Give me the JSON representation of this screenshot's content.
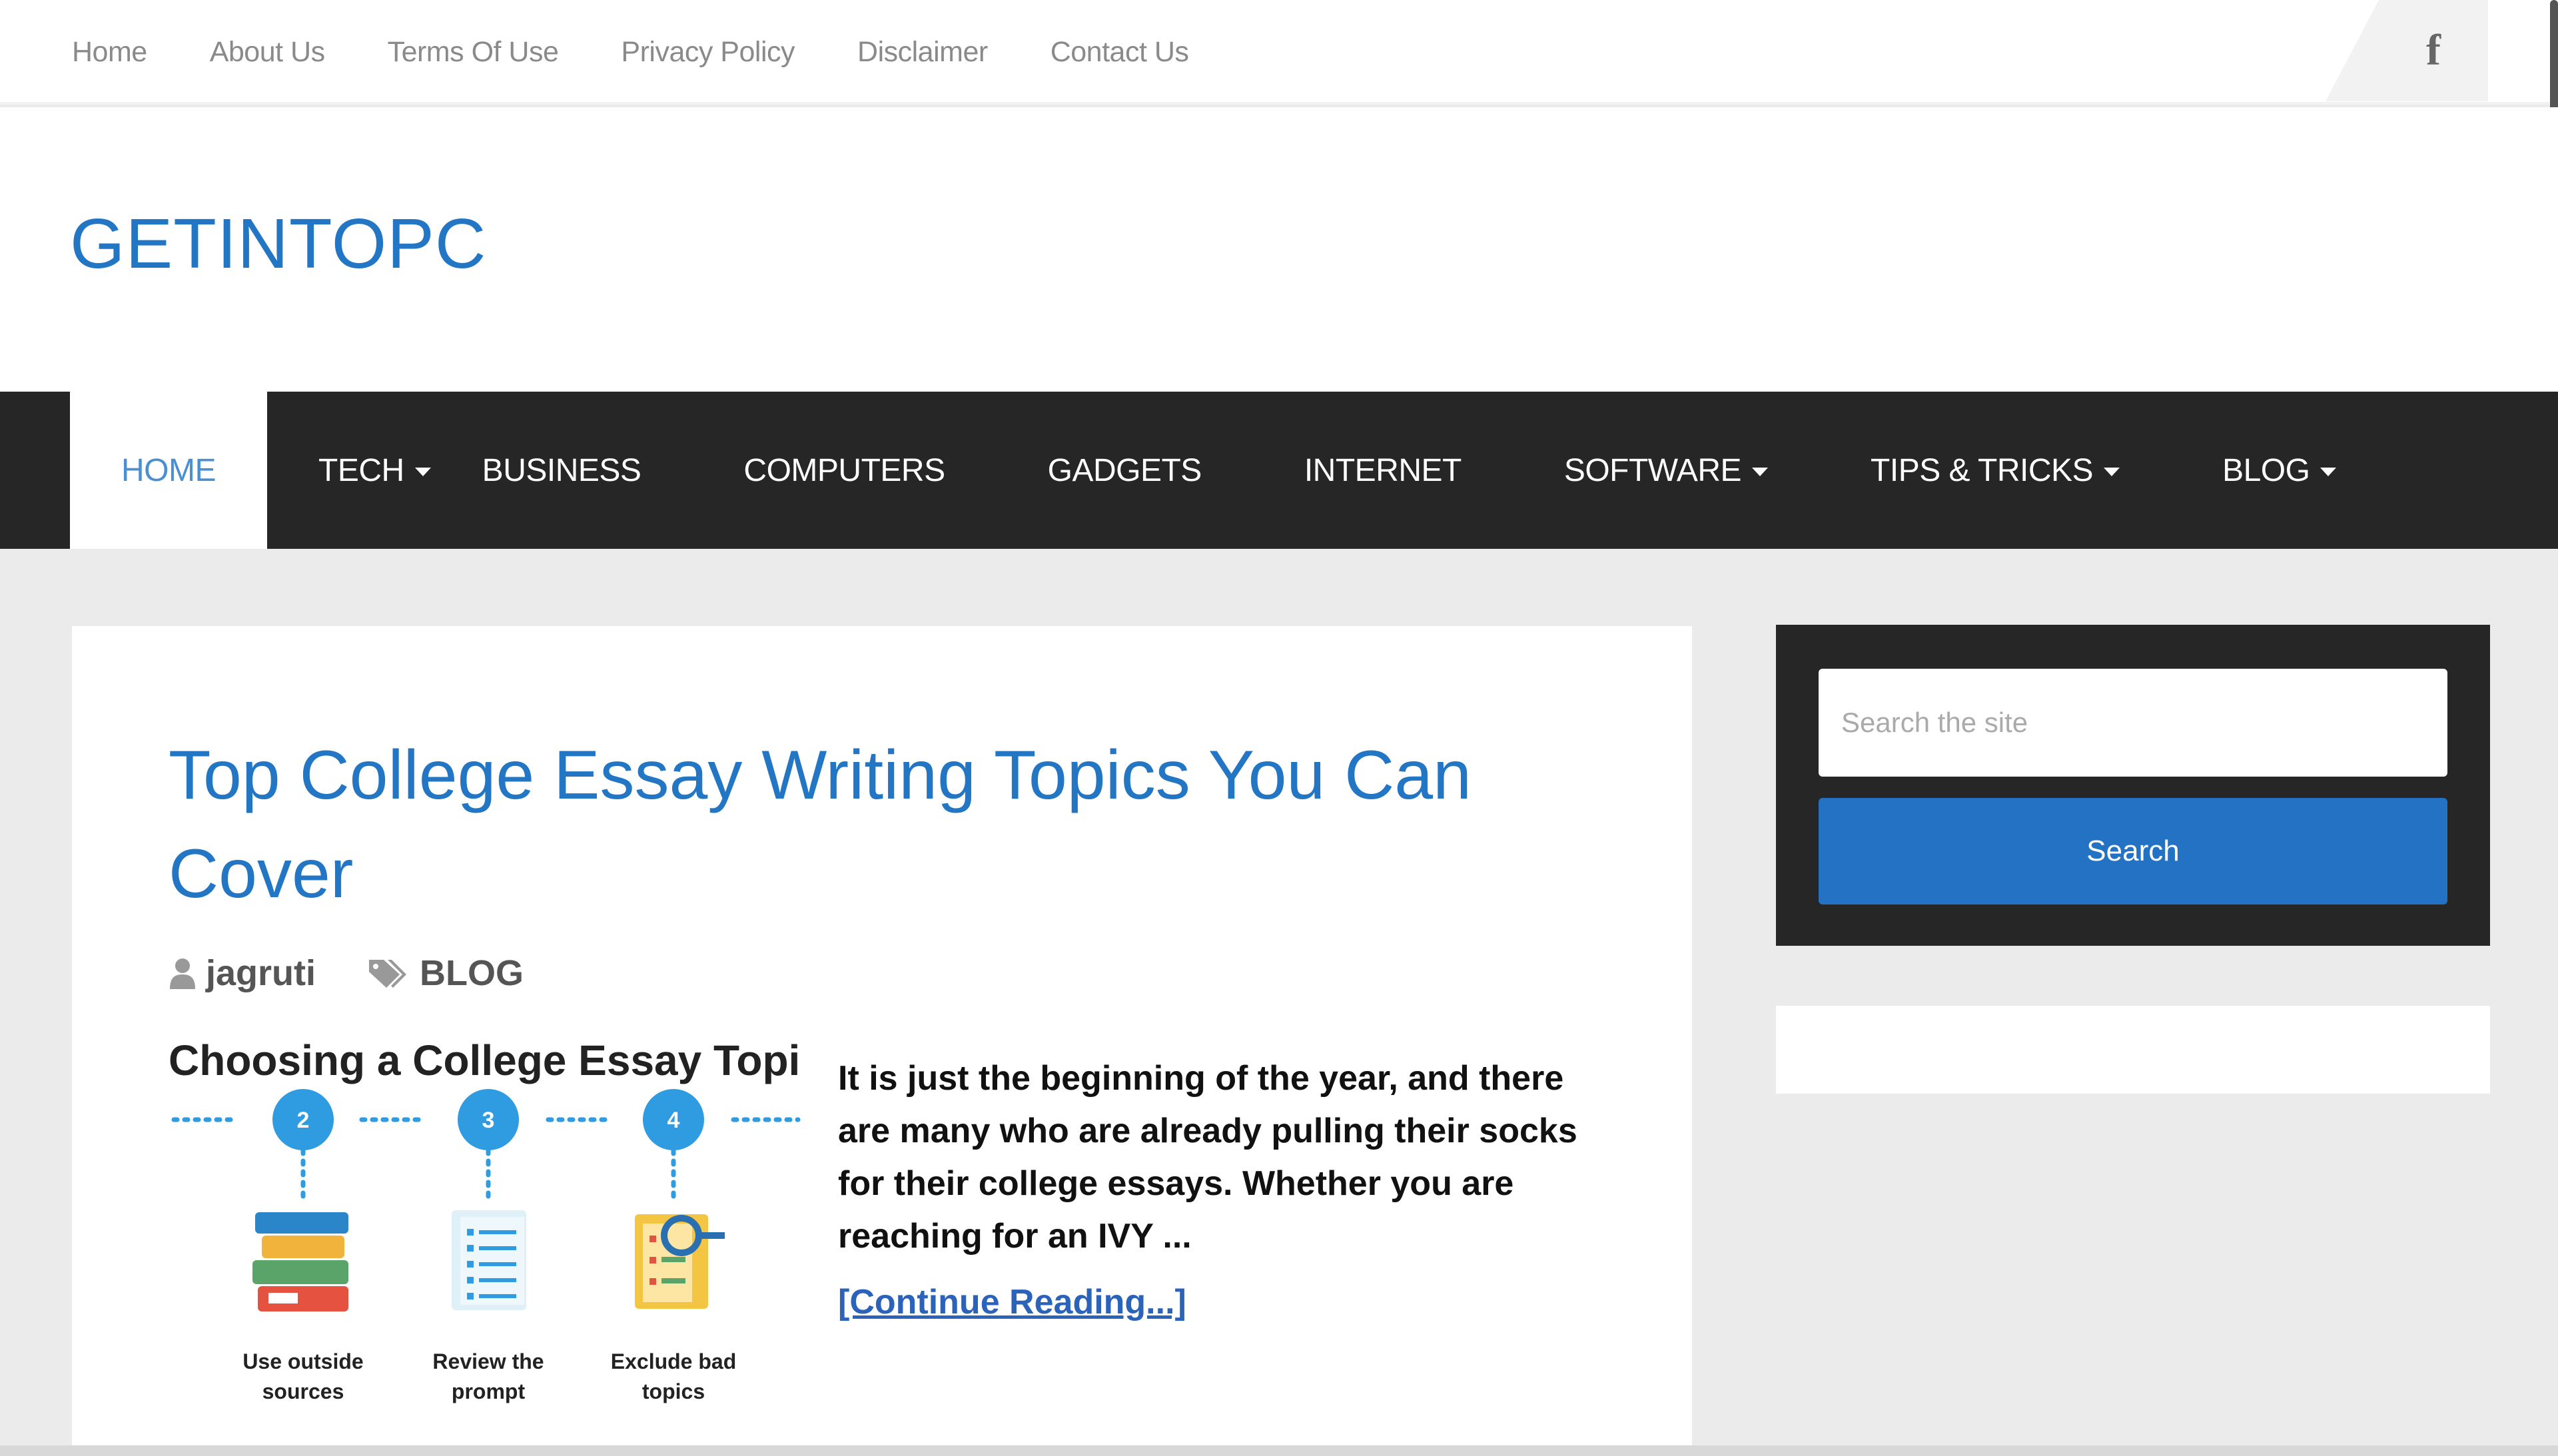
{
  "topnav": {
    "items": [
      "Home",
      "About Us",
      "Terms Of Use",
      "Privacy Policy",
      "Disclaimer",
      "Contact Us"
    ],
    "social_icon": "facebook-icon",
    "social_glyph": "f"
  },
  "header": {
    "logo": "GETINTOPC"
  },
  "mainnav": {
    "items": [
      {
        "label": "HOME",
        "active": true,
        "dropdown": false
      },
      {
        "label": "TECH",
        "dropdown": true
      },
      {
        "label": "BUSINESS",
        "dropdown": false
      },
      {
        "label": "COMPUTERS",
        "dropdown": false
      },
      {
        "label": "GADGETS",
        "dropdown": false
      },
      {
        "label": "INTERNET",
        "dropdown": false
      },
      {
        "label": "SOFTWARE",
        "dropdown": true
      },
      {
        "label": "TIPS & TRICKS",
        "dropdown": true
      },
      {
        "label": "BLOG",
        "dropdown": true
      }
    ]
  },
  "post": {
    "title": "Top College Essay Writing Topics You Can Cover",
    "author": "jagruti",
    "category": "BLOG",
    "excerpt": "It is just the beginning of the year, and there are many who are already pulling their socks for their college essays. Whether you are reaching for an IVY ...",
    "read_more": "[Continue Reading...]",
    "image": {
      "title": "Choosing a College Essay Topic",
      "steps": [
        {
          "num": "2",
          "label_lines": [
            "Use outside",
            "sources"
          ]
        },
        {
          "num": "3",
          "label_lines": [
            "Review the",
            "prompt"
          ]
        },
        {
          "num": "4",
          "label_lines": [
            "Exclude bad",
            "topics"
          ]
        }
      ]
    }
  },
  "sidebar": {
    "search_placeholder": "Search the site",
    "search_button": "Search"
  },
  "colors": {
    "accent": "#2276c4",
    "nav_bg": "#262626",
    "button": "#2372c4"
  }
}
